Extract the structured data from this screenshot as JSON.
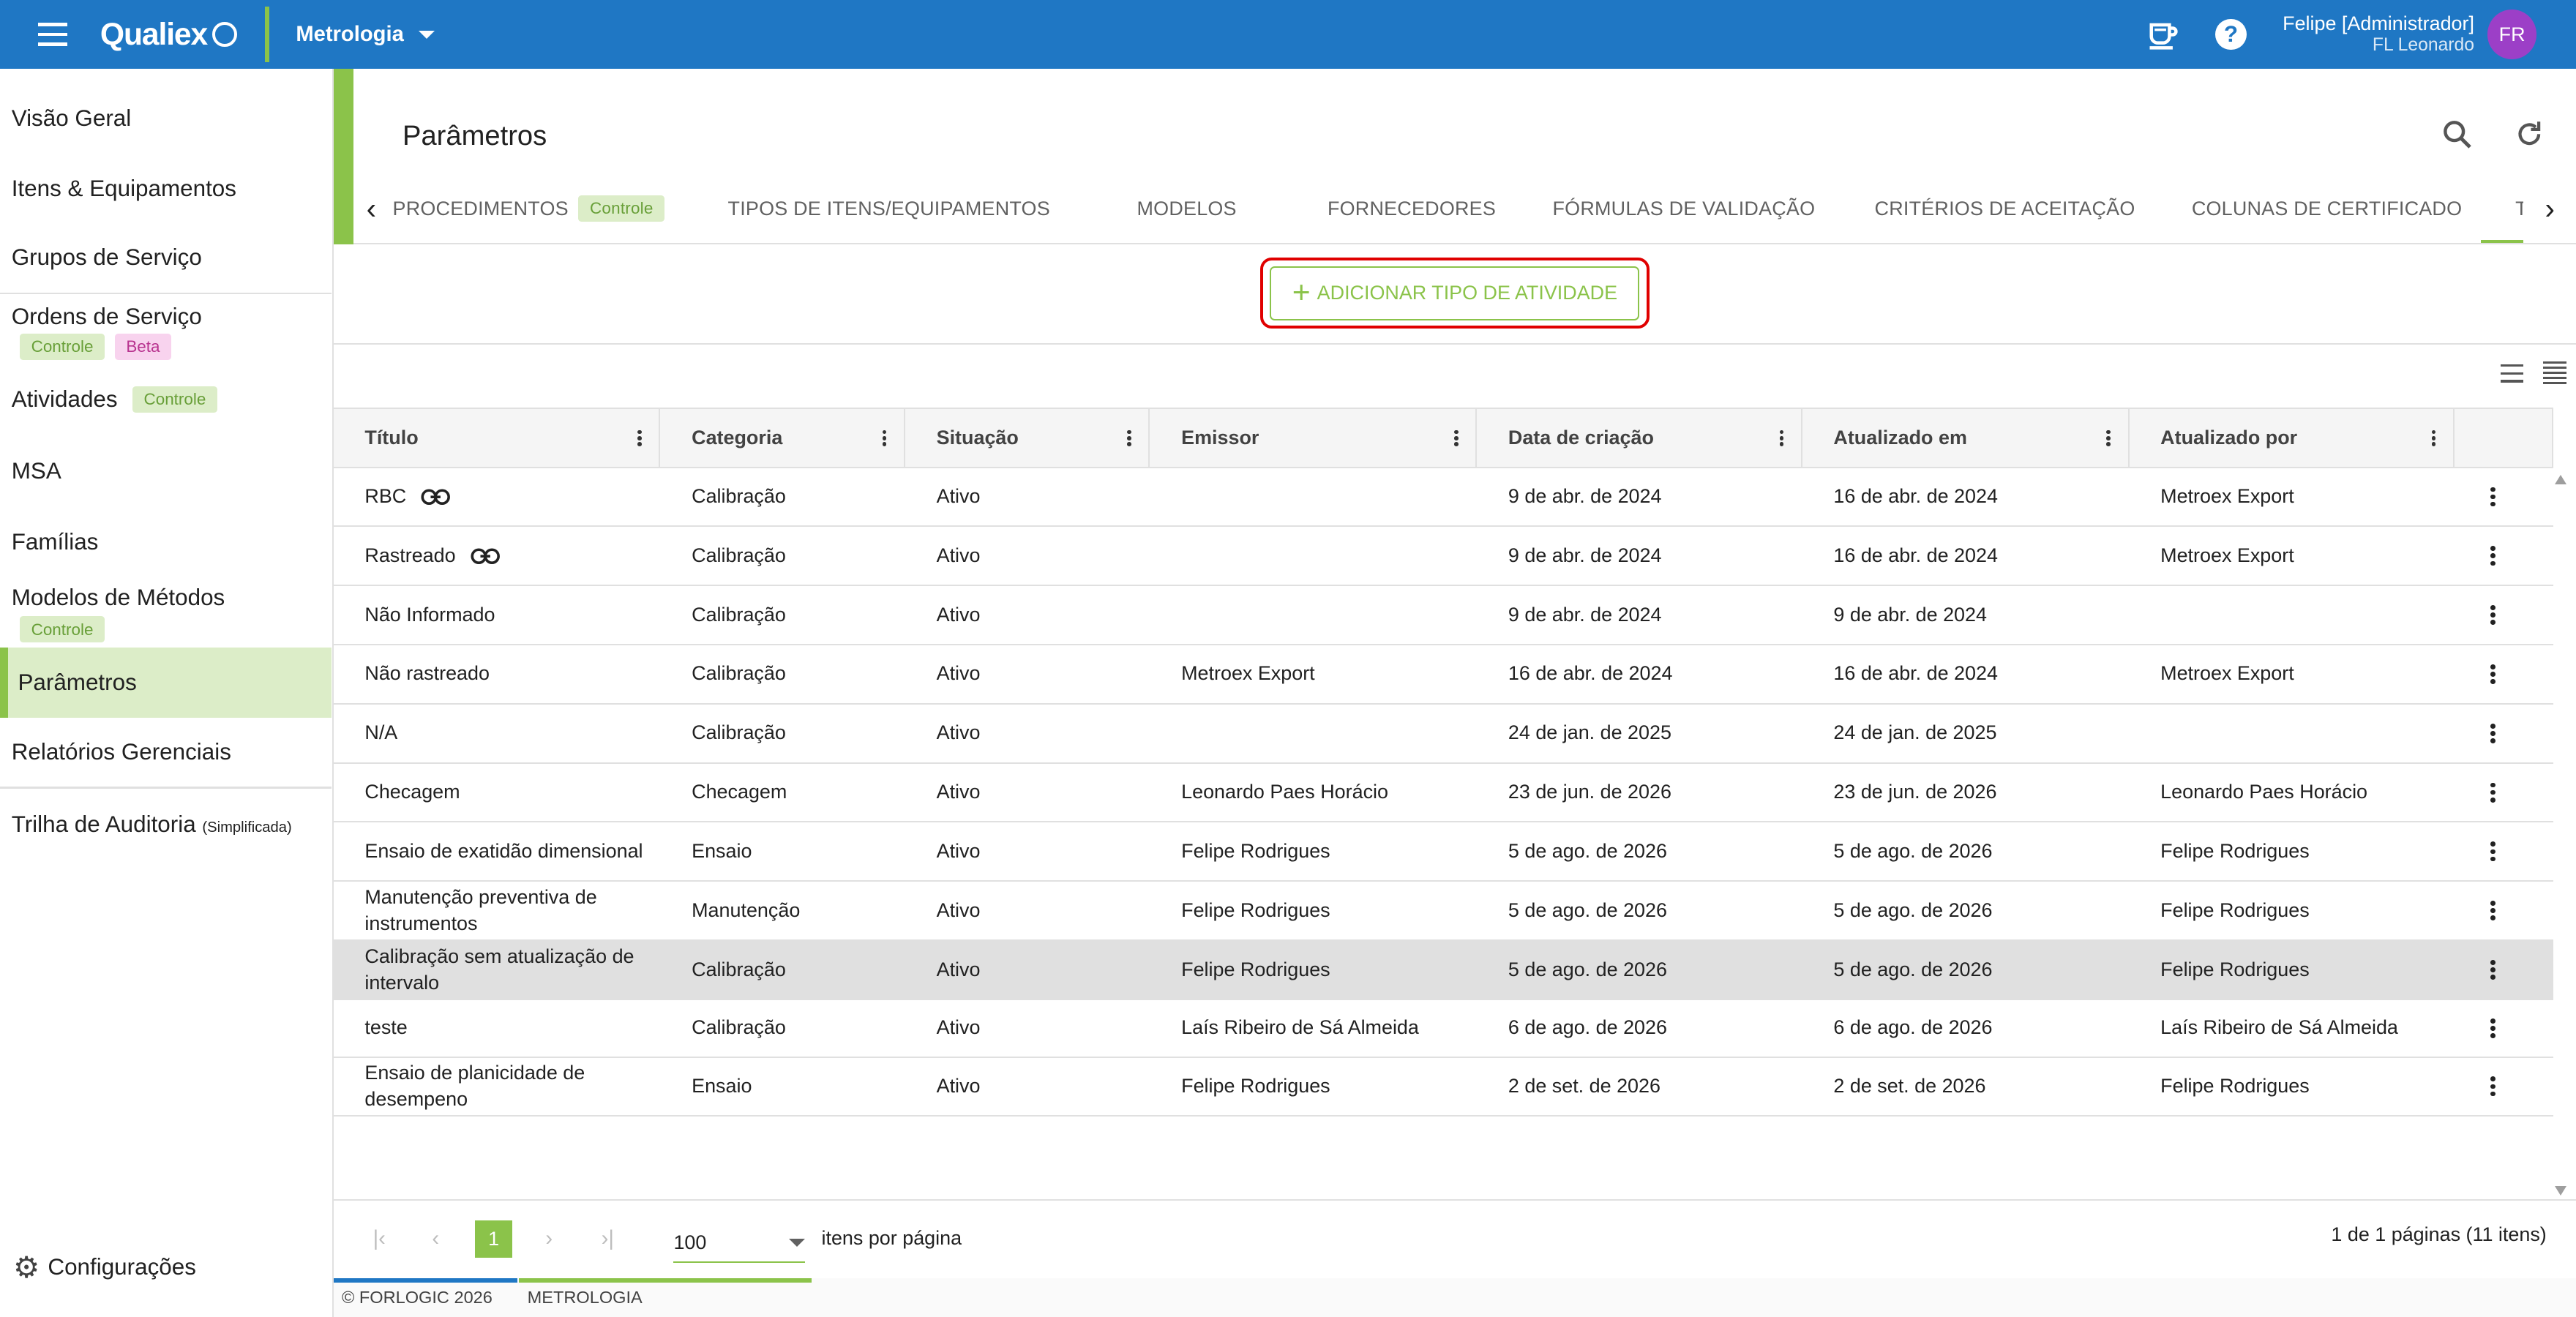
{
  "header": {
    "logo": "Qualiex",
    "module": "Metrologia",
    "user_name": "Felipe [Administrador]",
    "user_sub": "FL Leonardo",
    "avatar_initials": "FR"
  },
  "sidebar": {
    "items": [
      {
        "label": "Visão Geral"
      },
      {
        "label": "Itens & Equipamentos"
      },
      {
        "label": "Grupos de Serviço"
      },
      {
        "label": "Ordens de Serviço",
        "badges": [
          "Controle",
          "Beta"
        ]
      },
      {
        "label": "Atividades",
        "badges": [
          "Controle"
        ]
      },
      {
        "label": "MSA"
      },
      {
        "label": "Famílias"
      },
      {
        "label": "Modelos de Métodos",
        "badges": [
          "Controle"
        ]
      },
      {
        "label": "Parâmetros"
      },
      {
        "label": "Relatórios Gerenciais"
      },
      {
        "label": "Trilha de Auditoria",
        "suffix": "(Simplificada)"
      }
    ],
    "settings": "Configurações"
  },
  "page": {
    "title": "Parâmetros",
    "tabs": [
      {
        "label": "PROCEDIMENTOS",
        "badge": "Controle"
      },
      {
        "label": "TIPOS DE ITENS/EQUIPAMENTOS"
      },
      {
        "label": "MODELOS"
      },
      {
        "label": "FORNECEDORES"
      },
      {
        "label": "FÓRMULAS DE VALIDAÇÃO"
      },
      {
        "label": "CRITÉRIOS DE ACEITAÇÃO"
      },
      {
        "label": "COLUNAS DE CERTIFICADO"
      },
      {
        "label": "T"
      }
    ],
    "add_button": "ADICIONAR TIPO DE ATIVIDADE"
  },
  "table": {
    "columns": [
      "Título",
      "Categoria",
      "Situação",
      "Emissor",
      "Data de criação",
      "Atualizado em",
      "Atualizado por"
    ],
    "rows": [
      {
        "titulo": "RBC",
        "link": true,
        "categoria": "Calibração",
        "situacao": "Ativo",
        "emissor": "",
        "criacao": "9 de abr. de 2024",
        "atualizado": "16 de abr. de 2024",
        "por": "Metroex Export"
      },
      {
        "titulo": "Rastreado",
        "link": true,
        "categoria": "Calibração",
        "situacao": "Ativo",
        "emissor": "",
        "criacao": "9 de abr. de 2024",
        "atualizado": "16 de abr. de 2024",
        "por": "Metroex Export"
      },
      {
        "titulo": "Não Informado",
        "categoria": "Calibração",
        "situacao": "Ativo",
        "emissor": "",
        "criacao": "9 de abr. de 2024",
        "atualizado": "9 de abr. de 2024",
        "por": ""
      },
      {
        "titulo": "Não rastreado",
        "categoria": "Calibração",
        "situacao": "Ativo",
        "emissor": "Metroex Export",
        "criacao": "16 de abr. de 2024",
        "atualizado": "16 de abr. de 2024",
        "por": "Metroex Export"
      },
      {
        "titulo": "N/A",
        "categoria": "Calibração",
        "situacao": "Ativo",
        "emissor": "",
        "criacao": "24 de jan. de 2025",
        "atualizado": "24 de jan. de 2025",
        "por": ""
      },
      {
        "titulo": "Checagem",
        "categoria": "Checagem",
        "situacao": "Ativo",
        "emissor": "Leonardo Paes Horácio",
        "criacao": "23 de jun. de 2026",
        "atualizado": "23 de jun. de 2026",
        "por": "Leonardo Paes Horácio"
      },
      {
        "titulo": "Ensaio de exatidão dimensional",
        "categoria": "Ensaio",
        "situacao": "Ativo",
        "emissor": "Felipe Rodrigues",
        "criacao": "5 de ago. de 2026",
        "atualizado": "5 de ago. de 2026",
        "por": "Felipe Rodrigues"
      },
      {
        "titulo": "Manutenção preventiva de instrumentos",
        "categoria": "Manutenção",
        "situacao": "Ativo",
        "emissor": "Felipe Rodrigues",
        "criacao": "5 de ago. de 2026",
        "atualizado": "5 de ago. de 2026",
        "por": "Felipe Rodrigues"
      },
      {
        "titulo": "Calibração sem atualização de intervalo",
        "categoria": "Calibração",
        "situacao": "Ativo",
        "emissor": "Felipe Rodrigues",
        "criacao": "5 de ago. de 2026",
        "atualizado": "5 de ago. de 2026",
        "por": "Felipe Rodrigues",
        "selected": true
      },
      {
        "titulo": "teste",
        "categoria": "Calibração",
        "situacao": "Ativo",
        "emissor": "Laís Ribeiro de Sá Almeida",
        "criacao": "6 de ago. de 2026",
        "atualizado": "6 de ago. de 2026",
        "por": "Laís Ribeiro de Sá Almeida"
      },
      {
        "titulo": "Ensaio de planicidade de desempeno",
        "categoria": "Ensaio",
        "situacao": "Ativo",
        "emissor": "Felipe Rodrigues",
        "criacao": "2 de set. de 2026",
        "atualizado": "2 de set. de 2026",
        "por": "Felipe Rodrigues"
      }
    ]
  },
  "pager": {
    "page": "1",
    "page_size": "100",
    "per_page_label": "itens por página",
    "info": "1 de 1 páginas (11 itens)"
  },
  "footer": {
    "copyright": "© FORLOGIC 2026",
    "module": "METROLOGIA"
  },
  "colors": {
    "primary": "#1f77c4",
    "accent": "#8bc34a",
    "highlight": "#e00000"
  }
}
